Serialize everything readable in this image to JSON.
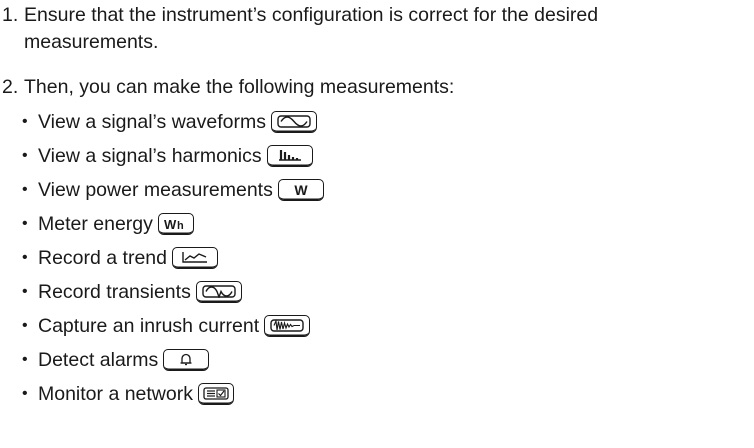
{
  "steps": [
    {
      "number": "1.",
      "line1": "Ensure that the instrument’s configuration is correct for the desired",
      "line2": "measurements."
    },
    {
      "number": "2.",
      "line1": "Then, you can make the following measurements:"
    }
  ],
  "bullet_symbol": "•",
  "measurements": [
    {
      "label": "View a signal’s waveforms",
      "icon": "waveform-key-icon"
    },
    {
      "label": "View a signal’s harmonics",
      "icon": "harmonics-key-icon"
    },
    {
      "label": "View power measurements",
      "icon": "power-w-key-icon"
    },
    {
      "label": "Meter energy",
      "icon": "energy-wh-key-icon"
    },
    {
      "label": "Record a trend",
      "icon": "trend-key-icon"
    },
    {
      "label": "Record transients",
      "icon": "transients-key-icon"
    },
    {
      "label": "Capture an inrush current",
      "icon": "inrush-key-icon"
    },
    {
      "label": "Detect alarms",
      "icon": "alarm-bell-key-icon"
    },
    {
      "label": "Monitor a network",
      "icon": "monitor-network-key-icon"
    }
  ],
  "key_labels": {
    "power": "W",
    "energy_w": "W",
    "energy_h": "h"
  }
}
